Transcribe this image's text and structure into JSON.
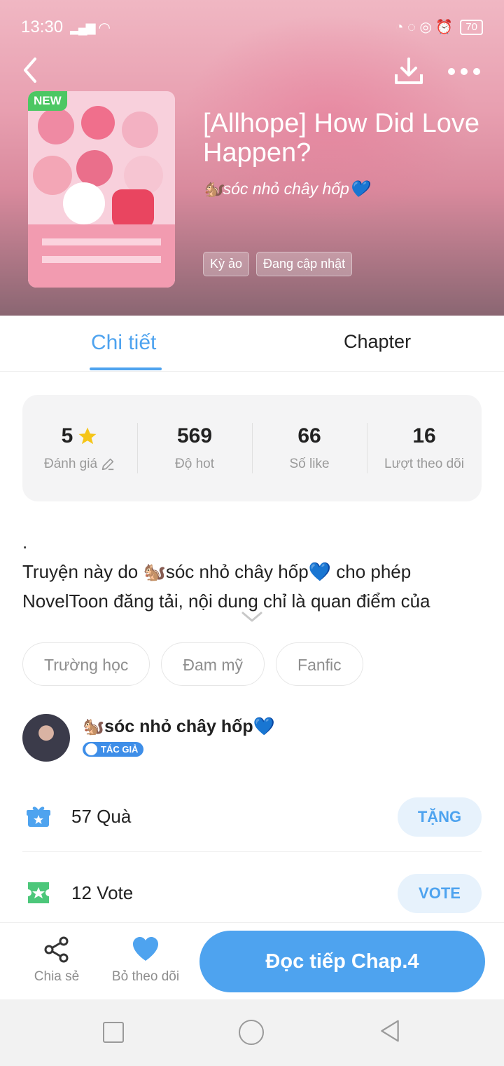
{
  "status_bar": {
    "time": "13:30",
    "battery": "70"
  },
  "header": {
    "new_badge": "NEW",
    "title": "[Allhope] How Did Love Happen?",
    "author": "🐿️sóc nhỏ chây hốp💙",
    "tags": [
      "Kỳ ảo",
      "Đang cập nhật"
    ]
  },
  "tabs": [
    {
      "label": "Chi tiết",
      "active": true
    },
    {
      "label": "Chapter",
      "active": false
    }
  ],
  "stats": [
    {
      "value": "5",
      "label": "Đánh giá"
    },
    {
      "value": "569",
      "label": "Độ hot"
    },
    {
      "value": "66",
      "label": "Số like"
    },
    {
      "value": "16",
      "label": "Lượt theo dõi"
    }
  ],
  "description": {
    "line1": ".",
    "line2": "Truyện này do 🐿️sóc nhỏ chây hốp💙 cho phép",
    "line3": "NovelToon đăng tải, nội dung chỉ là quan điểm của"
  },
  "chips": [
    "Trường học",
    "Đam mỹ",
    "Fanfic"
  ],
  "author": {
    "name": "🐿️sóc nhỏ chây hốp💙",
    "badge": "TÁC GIẢ"
  },
  "gift": {
    "count": "57",
    "label": "Quà",
    "button": "TẶNG"
  },
  "vote": {
    "count": "12",
    "label": "Vote",
    "button": "VOTE"
  },
  "actions": {
    "share": "Chia sẻ",
    "unfollow": "Bỏ theo dõi",
    "read": "Đọc tiếp Chap.4"
  },
  "colors": {
    "accent": "#4ea3ef",
    "new_badge": "#4cc763",
    "star": "#f5c518"
  }
}
